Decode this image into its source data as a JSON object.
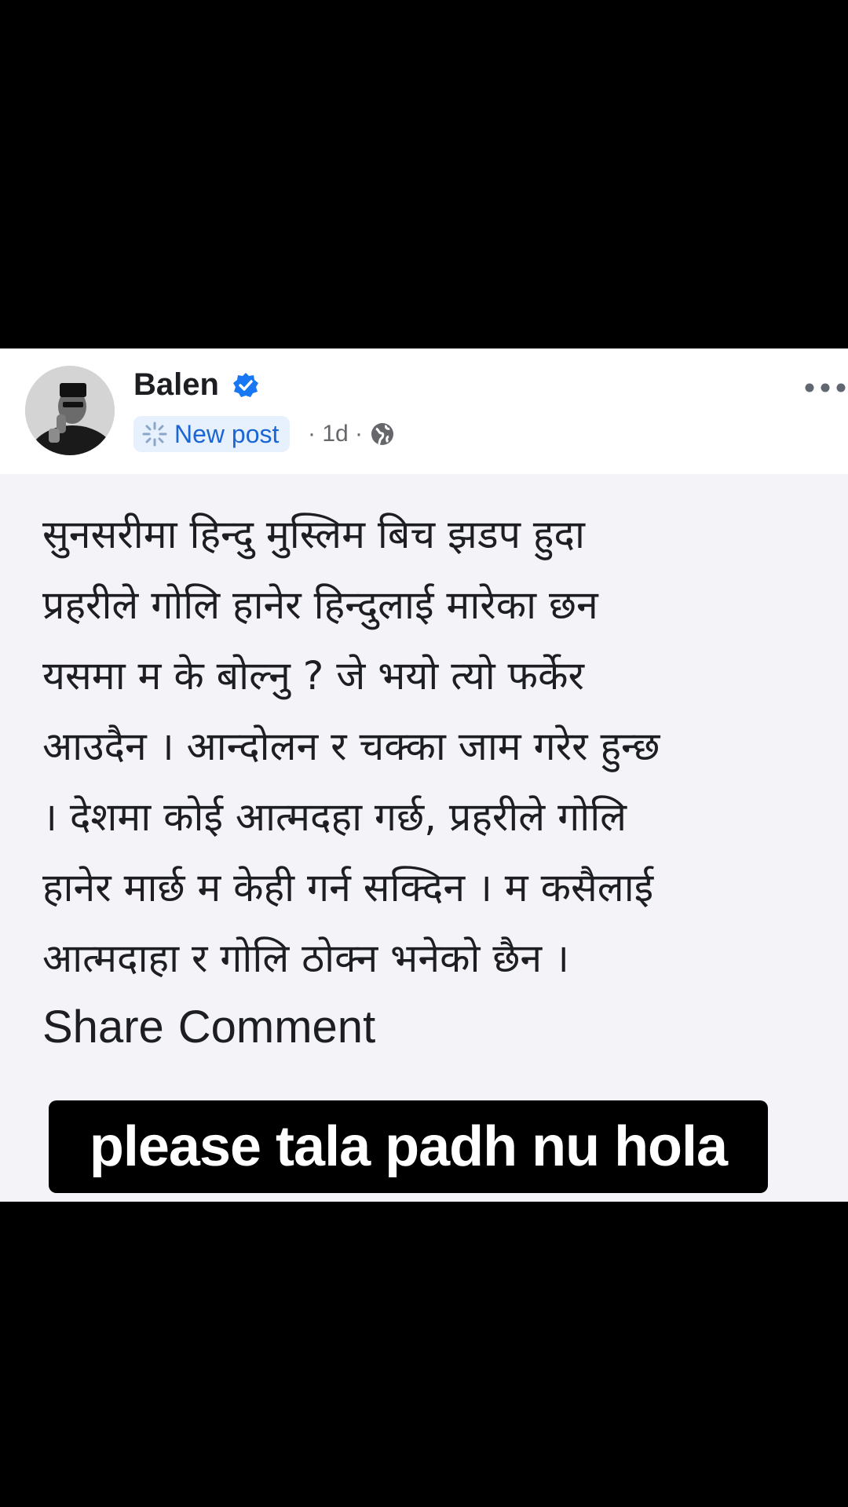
{
  "post": {
    "author": "Balen",
    "badge": "New post",
    "timestamp": "· 1d ·",
    "body_lines": [
      "सुनसरीमा हिन्दु मुस्लिम बिच झडप हुदा",
      "प्रहरीले गोलि हानेर हिन्दुलाई मारेका छन",
      "यसमा म के बोल्नु ? जे भयो त्यो फर्केर",
      "आउदैन । आन्दोलन र चक्का जाम गरेर हुन्छ",
      "। देशमा कोई आत्मदहा गर्छ, प्रहरीले गोलि",
      "हानेर मार्छ म केही गर्न सक्दिन । म कसैलाई",
      "आत्मदाहा र गोलि ठोक्न भनेको छैन ।"
    ],
    "actions": {
      "share": "Share",
      "comment": "Comment"
    }
  },
  "caption": "please tala padh nu hola",
  "icons": {
    "verified": "verified-badge-icon",
    "sparkle": "sparkle-icon",
    "globe": "globe-icon",
    "more": "more-options-icon"
  },
  "colors": {
    "verified_blue": "#1877f2",
    "badge_text": "#1b66d4",
    "badge_bg": "#e7f0fd",
    "card_bg": "#f4f4f8",
    "text": "#1c1e21",
    "meta": "#65676b"
  }
}
